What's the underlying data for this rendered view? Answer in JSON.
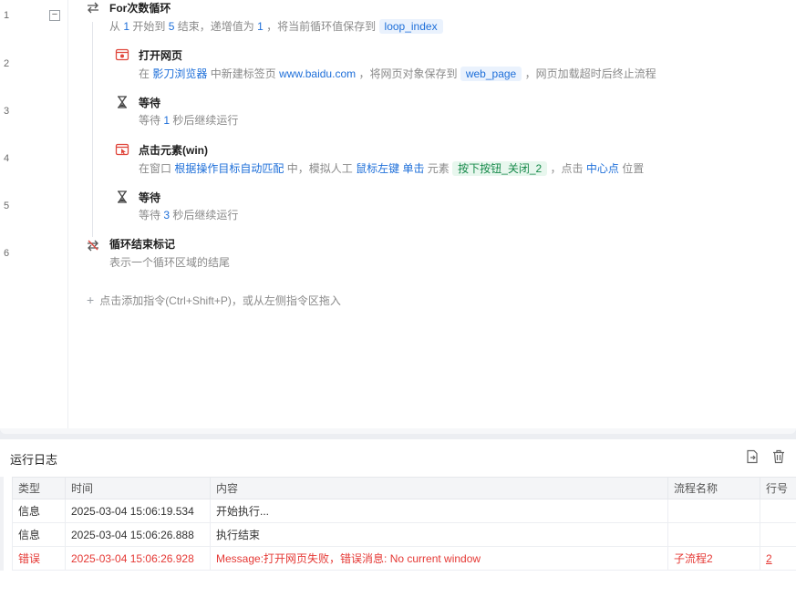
{
  "editor": {
    "line_numbers": [
      "1",
      "2",
      "3",
      "4",
      "5",
      "6"
    ],
    "collapse_symbol": "−",
    "loop": {
      "title": "For次数循环",
      "desc_1": "从",
      "start": "1",
      "desc_2": "开始到",
      "end": "5",
      "desc_3": "结束，递增值为",
      "step": "1",
      "desc_4": "，将当前循环值保存到",
      "var": "loop_index"
    },
    "open_page": {
      "title": "打开网页",
      "desc_1": "在",
      "browser": "影刀浏览器",
      "desc_2": "中新建标签页",
      "url": "www.baidu.com",
      "desc_3": "，将网页对象保存到",
      "var": "web_page",
      "desc_4": "，网页加载超时后终止流程"
    },
    "wait_1": {
      "title": "等待",
      "desc_1": "等待",
      "seconds": "1",
      "desc_2": "秒后继续运行"
    },
    "click": {
      "title": "点击元素(win)",
      "desc_1": "在窗口",
      "window": "根据操作目标自动匹配",
      "desc_2": "中，模拟人工",
      "button": "鼠标左键",
      "click_type": "单击",
      "desc_3": "元素",
      "element": "按下按钮_关闭_2",
      "desc_4": "，点击",
      "position": "中心点",
      "desc_5": "位置"
    },
    "wait_2": {
      "title": "等待",
      "desc_1": "等待",
      "seconds": "3",
      "desc_2": "秒后继续运行"
    },
    "loop_end": {
      "title": "循环结束标记",
      "desc": "表示一个循环区域的结尾"
    },
    "add_hint": "点击添加指令(Ctrl+Shift+P)，或从左侧指令区拖入"
  },
  "log": {
    "title": "运行日志",
    "columns": [
      "类型",
      "时间",
      "内容",
      "流程名称",
      "行号"
    ],
    "rows": [
      {
        "type": "信息",
        "time": "2025-03-04 15:06:19.534",
        "content": "开始执行...",
        "flow": "",
        "line": ""
      },
      {
        "type": "信息",
        "time": "2025-03-04 15:06:26.888",
        "content": "执行结束",
        "flow": "",
        "line": ""
      },
      {
        "type": "错误",
        "time": "2025-03-04 15:06:26.928",
        "content": "Message:打开网页失败，错误消息: No current window",
        "flow": "子流程2",
        "line": "2"
      }
    ]
  },
  "icons": {
    "loop": "loop-arrows-icon",
    "open_page": "browser-window-icon",
    "wait": "hourglass-icon",
    "click": "click-element-icon",
    "loop_end": "loop-end-icon",
    "add": "plus-icon",
    "export": "export-log-icon",
    "clear": "trash-icon"
  },
  "colors": {
    "accent_blue": "#1e6fd9",
    "element_green": "#16894a",
    "error_red": "#e53935",
    "icon_red": "#e0463c"
  }
}
